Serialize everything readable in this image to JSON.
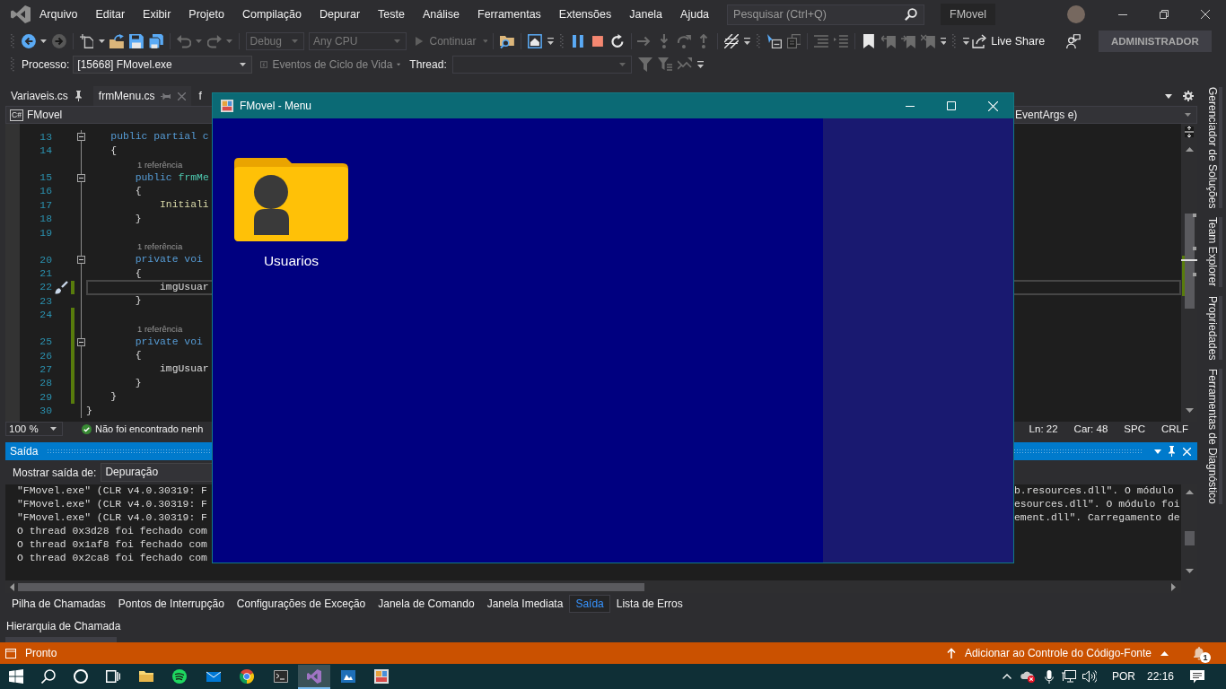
{
  "title_bar": {
    "menu": [
      "Arquivo",
      "Editar",
      "Exibir",
      "Projeto",
      "Compilação",
      "Depurar",
      "Teste",
      "Análise",
      "Ferramentas",
      "Extensões",
      "Janela",
      "Ajuda"
    ],
    "search": {
      "placeholder": "Pesquisar (Ctrl+Q)"
    },
    "solution": "FMovel"
  },
  "toolbar": {
    "bands": [
      {
        "groups": [
          [
            {
              "kind": "back",
              "disabled": false
            },
            {
              "kind": "dropdown",
              "disabled": false
            },
            {
              "kind": "forward",
              "disabled": true
            }
          ],
          [
            {
              "kind": "new_project",
              "disabled": false
            },
            {
              "kind": "dropdown",
              "disabled": false
            },
            {
              "kind": "open",
              "disabled": false
            },
            {
              "kind": "save",
              "disabled": false
            },
            {
              "kind": "save_all",
              "disabled": false
            }
          ],
          [
            {
              "kind": "undo",
              "disabled": true
            },
            {
              "kind": "dropdown",
              "disabled": true
            },
            {
              "kind": "redo",
              "disabled": true
            },
            {
              "kind": "dropdown",
              "disabled": true
            }
          ],
          [
            {
              "kind": "config_combo",
              "value": "Debug",
              "disabled": true
            },
            {
              "kind": "platform_combo",
              "value": "Any CPU",
              "disabled": true
            },
            {
              "kind": "run",
              "label": "Continuar",
              "disabled": true
            }
          ],
          [
            {
              "kind": "find_files",
              "disabled": false
            }
          ],
          [
            {
              "kind": "app_window",
              "disabled": false
            },
            {
              "kind": "overflow",
              "disabled": false
            }
          ]
        ]
      },
      {
        "groups": [
          [
            {
              "kind": "pause",
              "disabled": false
            },
            {
              "kind": "stop",
              "disabled": false
            },
            {
              "kind": "restart",
              "disabled": false
            }
          ],
          [
            {
              "kind": "next_statement",
              "disabled": true
            },
            {
              "kind": "step_into",
              "disabled": true
            },
            {
              "kind": "step_over",
              "disabled": true
            },
            {
              "kind": "step_out",
              "disabled": true
            }
          ],
          [
            {
              "kind": "threads",
              "disabled": false
            },
            {
              "kind": "overflow",
              "disabled": false
            }
          ]
        ]
      },
      {
        "groups": [
          [
            {
              "kind": "cursor_window",
              "disabled": false
            },
            {
              "kind": "pages",
              "disabled": true
            }
          ],
          [
            {
              "kind": "comment",
              "disabled": true
            },
            {
              "kind": "uncomment",
              "disabled": true
            }
          ],
          [
            {
              "kind": "bookmark",
              "disabled": false
            },
            {
              "kind": "bookmark_prev",
              "disabled": true
            },
            {
              "kind": "bookmark_next",
              "disabled": true
            },
            {
              "kind": "bookmark_clear",
              "disabled": true
            },
            {
              "kind": "overflow",
              "disabled": false
            }
          ]
        ]
      },
      {
        "groups": [
          [
            {
              "kind": "overflow",
              "disabled": false
            }
          ]
        ]
      }
    ],
    "live_share": "Live Share",
    "account": "ADMINISTRADOR"
  },
  "debug_bar": {
    "process_label": "Processo:",
    "process": "[15668] FMovel.exe",
    "lifecycle": {
      "label": "Eventos de Ciclo de Vida",
      "disabled": true
    },
    "thread_label": "Thread:",
    "thread": {
      "disabled": true
    },
    "tools": [
      {
        "kind": "filter",
        "disabled": true
      },
      {
        "kind": "filter_lines",
        "disabled": true
      },
      {
        "kind": "crossed_arrows",
        "disabled": true
      },
      {
        "kind": "overflow",
        "disabled": false
      }
    ]
  },
  "documents": {
    "tabs": [
      {
        "label": "Variaveis.cs",
        "pinned": true,
        "selected": false
      },
      {
        "label": "frmMenu.cs",
        "pinned": false,
        "selected": true
      },
      {
        "label": "f",
        "pinned": false,
        "selected": false
      }
    ]
  },
  "editor": {
    "language": "C#",
    "project": "FMovel",
    "member": "EventArgs e)",
    "rows": [
      {
        "kind": "block_start",
        "number": "13",
        "expanded": true,
        "changed": false,
        "current": false,
        "tokens": [
          {
            "text": "    public partial c",
            "kind": "keyword"
          }
        ]
      },
      {
        "kind": "line",
        "number": "14",
        "changed": false,
        "current": false,
        "tokens": [
          {
            "text": "    {",
            "kind": "plain"
          }
        ]
      },
      {
        "kind": "block_start",
        "number": "15",
        "lens": "1 referência",
        "expanded": true,
        "changed": false,
        "current": false,
        "tokens": [
          {
            "text": "        public ",
            "kind": "keyword"
          },
          {
            "text": "frmMe",
            "kind": "type"
          }
        ]
      },
      {
        "kind": "line",
        "number": "16",
        "changed": false,
        "current": false,
        "tokens": [
          {
            "text": "        {",
            "kind": "plain"
          }
        ]
      },
      {
        "kind": "line",
        "number": "17",
        "changed": false,
        "current": false,
        "tokens": [
          {
            "text": "            Initiali",
            "kind": "method"
          }
        ]
      },
      {
        "kind": "line",
        "number": "18",
        "changed": false,
        "current": false,
        "tokens": [
          {
            "text": "        }",
            "kind": "plain"
          }
        ]
      },
      {
        "kind": "line",
        "number": "19",
        "changed": false,
        "current": false
      },
      {
        "kind": "block_start",
        "number": "20",
        "lens": "1 referência",
        "expanded": true,
        "changed": false,
        "current": false,
        "tokens": [
          {
            "text": "        private voi",
            "kind": "keyword"
          }
        ]
      },
      {
        "kind": "line",
        "number": "21",
        "changed": false,
        "current": false,
        "tokens": [
          {
            "text": "        {",
            "kind": "plain"
          }
        ]
      },
      {
        "kind": "line",
        "number": "22",
        "changed": true,
        "current": true,
        "tokens": [
          {
            "text": "            imgUsuar",
            "kind": "plain"
          }
        ]
      },
      {
        "kind": "line",
        "number": "23",
        "changed": false,
        "current": false,
        "tokens": [
          {
            "text": "        }",
            "kind": "plain"
          }
        ]
      },
      {
        "kind": "line",
        "number": "24",
        "changed": true,
        "current": false
      },
      {
        "kind": "block_start",
        "number": "25",
        "lens": "1 referência",
        "expanded": true,
        "changed": true,
        "current": false,
        "tokens": [
          {
            "text": "        private voi",
            "kind": "keyword"
          }
        ]
      },
      {
        "kind": "line",
        "number": "26",
        "changed": true,
        "current": false,
        "tokens": [
          {
            "text": "        {",
            "kind": "plain"
          }
        ]
      },
      {
        "kind": "line",
        "number": "27",
        "changed": true,
        "current": false,
        "tokens": [
          {
            "text": "            imgUsuar",
            "kind": "plain"
          }
        ]
      },
      {
        "kind": "line",
        "number": "28",
        "changed": true,
        "current": false,
        "tokens": [
          {
            "text": "        }",
            "kind": "plain"
          }
        ]
      },
      {
        "kind": "line",
        "number": "29",
        "changed": true,
        "current": false,
        "tokens": [
          {
            "text": "    }",
            "kind": "plain"
          }
        ]
      },
      {
        "kind": "line",
        "number": "30",
        "changed": false,
        "current": false,
        "tokens": [
          {
            "text": "}",
            "kind": "plain"
          }
        ]
      }
    ],
    "zoom": "100 %",
    "issues": "Não foi encontrado nenh",
    "line": "Ln: 22",
    "column": "Car: 48",
    "indent": "SPC",
    "line_ending": "CRLF"
  },
  "output": {
    "title": "Saída",
    "source_label": "Mostrar saída de:",
    "source": "Depuração",
    "lines": [
      {
        "start": "\"FMovel.exe\" (CLR v4.0.30319: F",
        "end": "b.resources.dll\". O módulo"
      },
      {
        "start": "\"FMovel.exe\" (CLR v4.0.30319: F",
        "end": "esources.dll\". O módulo foi"
      },
      {
        "start": "\"FMovel.exe\" (CLR v4.0.30319: F",
        "end": "ement.dll\". Carregamento de"
      },
      {
        "start": "O thread 0x3d28 foi fechado com"
      },
      {
        "start": "O thread 0x1af8 foi fechado com"
      },
      {
        "start": "O thread 0x2ca8 foi fechado com"
      }
    ]
  },
  "tool_tabs": [
    {
      "label": "Pilha de Chamadas",
      "selected": false
    },
    {
      "label": "Pontos de Interrupção",
      "selected": false
    },
    {
      "label": "Configurações de Exceção",
      "selected": false
    },
    {
      "label": "Janela de Comando",
      "selected": false
    },
    {
      "label": "Janela Imediata",
      "selected": false
    },
    {
      "label": "Saída",
      "selected": true
    },
    {
      "label": "Lista de Erros",
      "selected": false
    }
  ],
  "tool_tabs_2": [
    {
      "label": "Hierarquia de Chamada",
      "selected": false
    }
  ],
  "side_tabs": [
    "Gerenciador de Soluções",
    "Team Explorer",
    "Propriedades",
    "Ferramentas de Diagnóstico"
  ],
  "status_bar": {
    "state": "Pronto",
    "source_control": "Adicionar ao Controle do Código-Fonte",
    "notifications": "1"
  },
  "app_window": {
    "title": "FMovel - Menu",
    "items": [
      {
        "label": "Usuarios"
      }
    ]
  },
  "taskbar": {
    "apps": [
      {
        "kind": "explorer",
        "selected": false
      },
      {
        "kind": "music",
        "selected": false
      },
      {
        "kind": "mail",
        "selected": false
      },
      {
        "kind": "browser",
        "selected": false
      },
      {
        "kind": "terminal",
        "selected": false
      },
      {
        "kind": "ide",
        "selected": true
      },
      {
        "kind": "remote",
        "selected": false
      },
      {
        "kind": "form_app",
        "selected": false
      }
    ],
    "language": "POR",
    "time": "22:16"
  }
}
